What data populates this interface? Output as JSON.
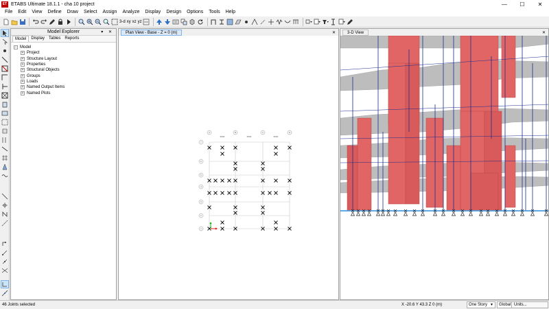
{
  "window": {
    "app_icon_text": "ET",
    "title": "ETABS Ultimate 18.1.1 - cha 10 project",
    "minimize": "—",
    "maximize": "☐",
    "close": "✕"
  },
  "menu": [
    "File",
    "Edit",
    "View",
    "Define",
    "Draw",
    "Select",
    "Assign",
    "Analyze",
    "Display",
    "Design",
    "Options",
    "Tools",
    "Help"
  ],
  "toolbar": {
    "view_3d_label": "3-d",
    "plan_label": "xy",
    "elev_label": "xz",
    "yz_label": "yz",
    "icons": [
      "new-icon",
      "open-icon",
      "save-icon",
      "undo-icon",
      "redo-icon",
      "draw-icon",
      "lock-icon",
      "run-icon",
      "zoom-window-icon",
      "zoom-in-icon",
      "zoom-out-icon",
      "zoom-full-icon",
      "pan-icon",
      "up-icon",
      "down-icon",
      "set-display-icon",
      "object-shrink-icon",
      "refresh-icon"
    ]
  },
  "explorer": {
    "title": "Model Explorer",
    "controls": "▾ ✕",
    "tabs": [
      "Model",
      "Display",
      "Tables",
      "Reports"
    ],
    "root": "Model",
    "items": [
      "Project",
      "Structure Layout",
      "Properties",
      "Structural Objects",
      "Groups",
      "Loads",
      "Named Output Items",
      "Named Plots"
    ]
  },
  "plan_view": {
    "tab_label": "Plan View - Base - Z = 0 (m)",
    "close": "✕",
    "grid_x_labels": [
      "A",
      "B",
      "C",
      "D"
    ],
    "grid_y_labels": [
      "1",
      "2",
      "3",
      "4",
      "5",
      "6",
      "7"
    ],
    "dim_top": "6000"
  },
  "view_3d": {
    "tab_label": "3-D View",
    "colors": {
      "shear_wall": "#e46666",
      "slab": "#b9b9b9",
      "column": "#1a2d8c",
      "base": "#4a9de0"
    }
  },
  "status": {
    "selection": "46 Joints selected",
    "coords": "X -20.6  Y 43.3  Z 0 (m)",
    "story_dropdown": "One Story",
    "coord_dropdown": "Global",
    "units_button": "Units..."
  }
}
